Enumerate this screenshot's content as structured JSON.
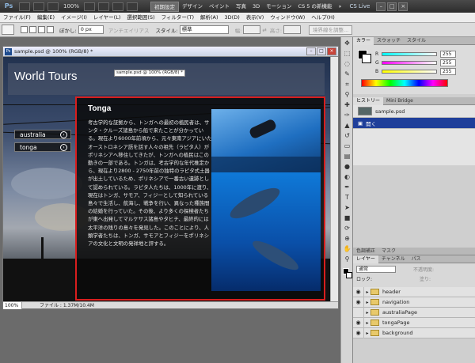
{
  "app": {
    "logo": "Ps",
    "zoom": "100%",
    "workspaces": [
      "初期設定",
      "デザイン",
      "ペイント",
      "写真",
      "3D",
      "モーション",
      "CS 5 の新機能"
    ],
    "active_workspace": "初期設定",
    "cslive": "CS Live"
  },
  "menu": [
    "ファイル(F)",
    "編集(E)",
    "イメージ(I)",
    "レイヤー(L)",
    "選択範囲(S)",
    "フィルター(T)",
    "解析(A)",
    "3D(D)",
    "表示(V)",
    "ウィンドウ(W)",
    "ヘルプ(H)"
  ],
  "options": {
    "feather_label": "ぼかし:",
    "feather_value": "0 px",
    "antialias": "アンチエイリアス",
    "style_label": "スタイル:",
    "style_value": "標準",
    "width_label": "幅:",
    "height_label": "高さ:",
    "refine_edge": "境界線を調整..."
  },
  "document": {
    "title": "sample.psd @ 100% (RGB/8) *",
    "canvas_tag": "sample.psd @ 100% (RGB/8) *",
    "zoom": "100%",
    "file_info": "ファイル : 1.37M/10.4M"
  },
  "site": {
    "title": "World Tours",
    "nav": [
      {
        "label": "australia"
      },
      {
        "label": "tonga"
      }
    ],
    "heading": "Tonga",
    "body": "考古学的な証拠から、トンガへの最初の植民者は、サンタ・クルーズ諸島から船で来たことが分かっている。現在より6000年前頃から、元々東南アジアにいたオーストロネシア語を話す人々の祖先（ラピタ人）がポリネシアへ移住してきたが、トンガへの植民はこの動きの一部である。トンガは、考古学的な年代推定から、現在より2800 - 2750年前の独特のラピタ式土器が出土しているため、ポリネシアで一番古い遺跡として認められている。ラピタ人たちは、1000年に渡り、現在はトンガ、サモア、フィジーとして知られている島々で生活し、航海し、戦争を行い、異なった種族間の結婚を行っていた。その後、より多くの探検者たちが東へ出発してマルケサス諸島やタヒチ、最終的には太平洋の残りの島々を発見した。このことにより、人類学者たちは、トンガ、サモアとフィジーをポリネシアの文化と文明の発祥地と評する。"
  },
  "tools_icons": [
    "move-icon",
    "marquee-icon",
    "lasso-icon",
    "quick-select-icon",
    "crop-icon",
    "eyedropper-icon",
    "healing-icon",
    "brush-icon",
    "stamp-icon",
    "history-brush-icon",
    "eraser-icon",
    "gradient-icon",
    "blur-icon",
    "dodge-icon",
    "pen-icon",
    "type-icon",
    "path-select-icon",
    "shape-icon",
    "3d-rotate-icon",
    "3d-orbit-icon",
    "hand-icon",
    "zoom-icon"
  ],
  "color_panel": {
    "tabs": [
      "カラー",
      "スウォッチ",
      "スタイル"
    ],
    "channels": [
      {
        "name": "R",
        "value": "255",
        "color": "#ff5050"
      },
      {
        "name": "G",
        "value": "255",
        "color": "#50ff50"
      },
      {
        "name": "B",
        "value": "255",
        "color": "#5050ff"
      }
    ]
  },
  "history_panel": {
    "tabs": [
      "ヒストリー",
      "Mini Bridge"
    ],
    "snapshot": "sample.psd",
    "items": [
      "開く"
    ]
  },
  "adjust_tabs": [
    "色調補正",
    "マスク"
  ],
  "layers_panel": {
    "tabs": [
      "レイヤー",
      "チャンネル",
      "パス"
    ],
    "blend_mode": "通常",
    "opacity_label": "不透明度:",
    "lock_label": "ロック:",
    "fill_label": "塗り:",
    "layers": [
      "header",
      "navigation",
      "australiaPage",
      "tongaPage",
      "background"
    ]
  }
}
